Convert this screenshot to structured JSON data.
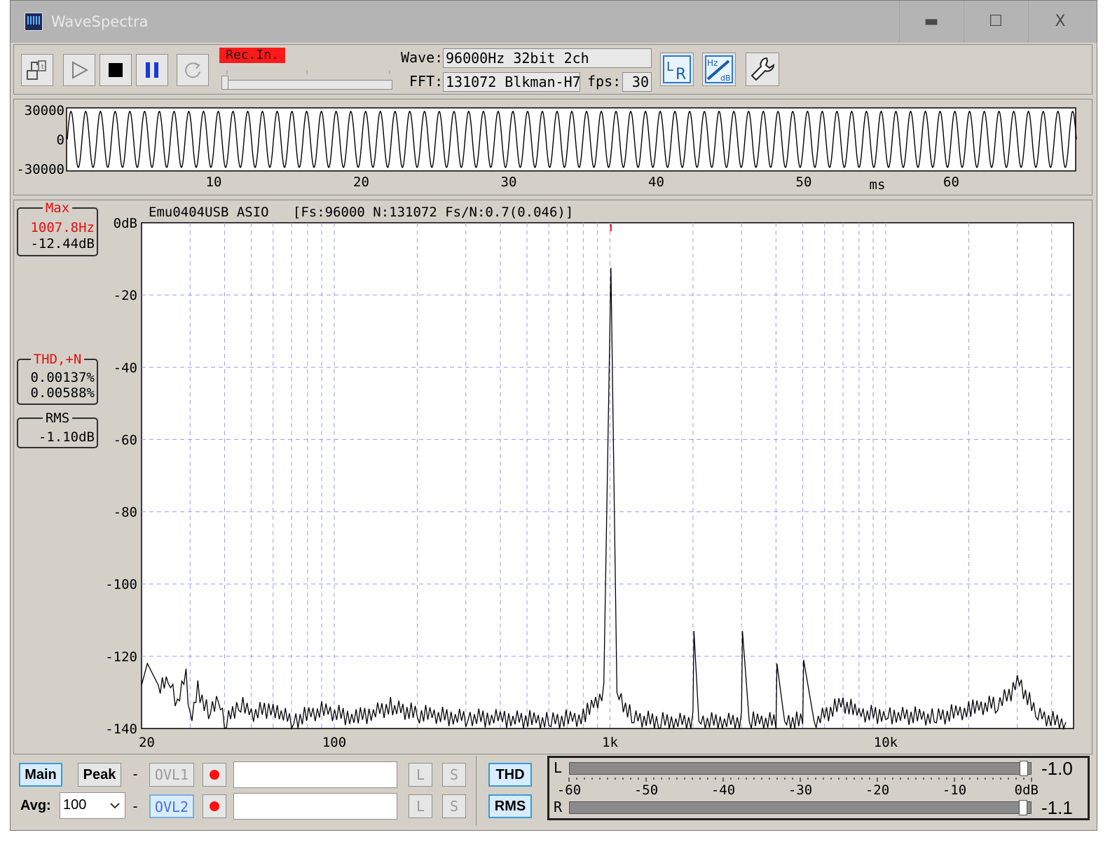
{
  "window": {
    "title": "WaveSpectra",
    "controls": {
      "minimize": "▬",
      "maximize": "☐",
      "close": "X"
    }
  },
  "toolbar": {
    "rec_label": "Rec.In.",
    "wave_label": "Wave:",
    "wave_value": "96000Hz 32bit 2ch",
    "fft_label": "FFT:",
    "fft_value": "131072 Blkman-H7",
    "fps_label": "fps:",
    "fps_value": "30",
    "buttons": [
      "open-file",
      "play",
      "stop",
      "pause",
      "loop"
    ],
    "icons": [
      "lr-icon",
      "hz-db-icon",
      "wrench-icon"
    ]
  },
  "waveform": {
    "y_ticks": [
      "30000",
      "0",
      "-30000"
    ],
    "x_ticks": [
      "10",
      "20",
      "30",
      "40",
      "50",
      "60"
    ],
    "x_unit": "ms"
  },
  "spectrum": {
    "header": "Emu0404USB ASIO   [Fs:96000 N:131072 Fs/N:0.7(0.046)]",
    "max_caption": "Max",
    "max_freq": "1007.8Hz",
    "max_level": "-12.44dB",
    "thd_caption": "THD,+N",
    "thd_value": "0.00137%",
    "thdn_value": "0.00588%",
    "rms_caption": "RMS",
    "rms_value": "-1.10dB",
    "y_ticks": [
      "0dB",
      "-20",
      "-40",
      "-60",
      "-80",
      "-100",
      "-120",
      "-140"
    ],
    "x_ticks": [
      "20",
      "100",
      "1k",
      "10k"
    ]
  },
  "chart_data": {
    "type": "line",
    "xlabel": "",
    "ylabel": "",
    "x_scale": "log",
    "xlim": [
      20,
      48000
    ],
    "ylim": [
      -140,
      0
    ],
    "grid": true,
    "series": [
      {
        "x": [
          20,
          21,
          23,
          25,
          27,
          29,
          30,
          32,
          35,
          38,
          40,
          45,
          50,
          60,
          70,
          90,
          120,
          160,
          200,
          300,
          400,
          600,
          800,
          950,
          1007.8,
          1060,
          1200,
          1500,
          2000,
          2016,
          2100,
          3000,
          3023,
          3200,
          4000,
          4031,
          4300,
          5000,
          5039,
          5500,
          7000,
          8000,
          10000,
          15000,
          20000,
          25000,
          28000,
          30000,
          35000,
          45000
        ],
        "y": [
          -128,
          -122,
          -128,
          -126,
          -133,
          -125,
          -138,
          -129,
          -136,
          -131,
          -139,
          -133,
          -136,
          -134,
          -138,
          -135,
          -137,
          -134,
          -136,
          -137,
          -137,
          -138,
          -137,
          -130,
          -12.44,
          -130,
          -137,
          -138,
          -138,
          -113,
          -138,
          -138,
          -113,
          -138,
          -138,
          -122,
          -138,
          -138,
          -121,
          -138,
          -133,
          -136,
          -136,
          -137,
          -135,
          -133,
          -131,
          -126,
          -136,
          -139
        ]
      }
    ]
  },
  "bottom": {
    "main_label": "Main",
    "peak_label": "Peak",
    "dash": "-",
    "ovl1_label": "OVL1",
    "ovl2_label": "OVL2",
    "avg_label": "Avg:",
    "avg_value": "100",
    "l_label": "L",
    "s_label": "S",
    "thd_label": "THD",
    "rms_label": "RMS"
  },
  "meter": {
    "l_label": "L",
    "r_label": "R",
    "l_value": "-1.0",
    "r_value": "-1.1",
    "l_level_db": -1.0,
    "r_level_db": -1.1,
    "scale": [
      "-60",
      "-50",
      "-40",
      "-30",
      "-20",
      "-10",
      "0dB"
    ]
  }
}
